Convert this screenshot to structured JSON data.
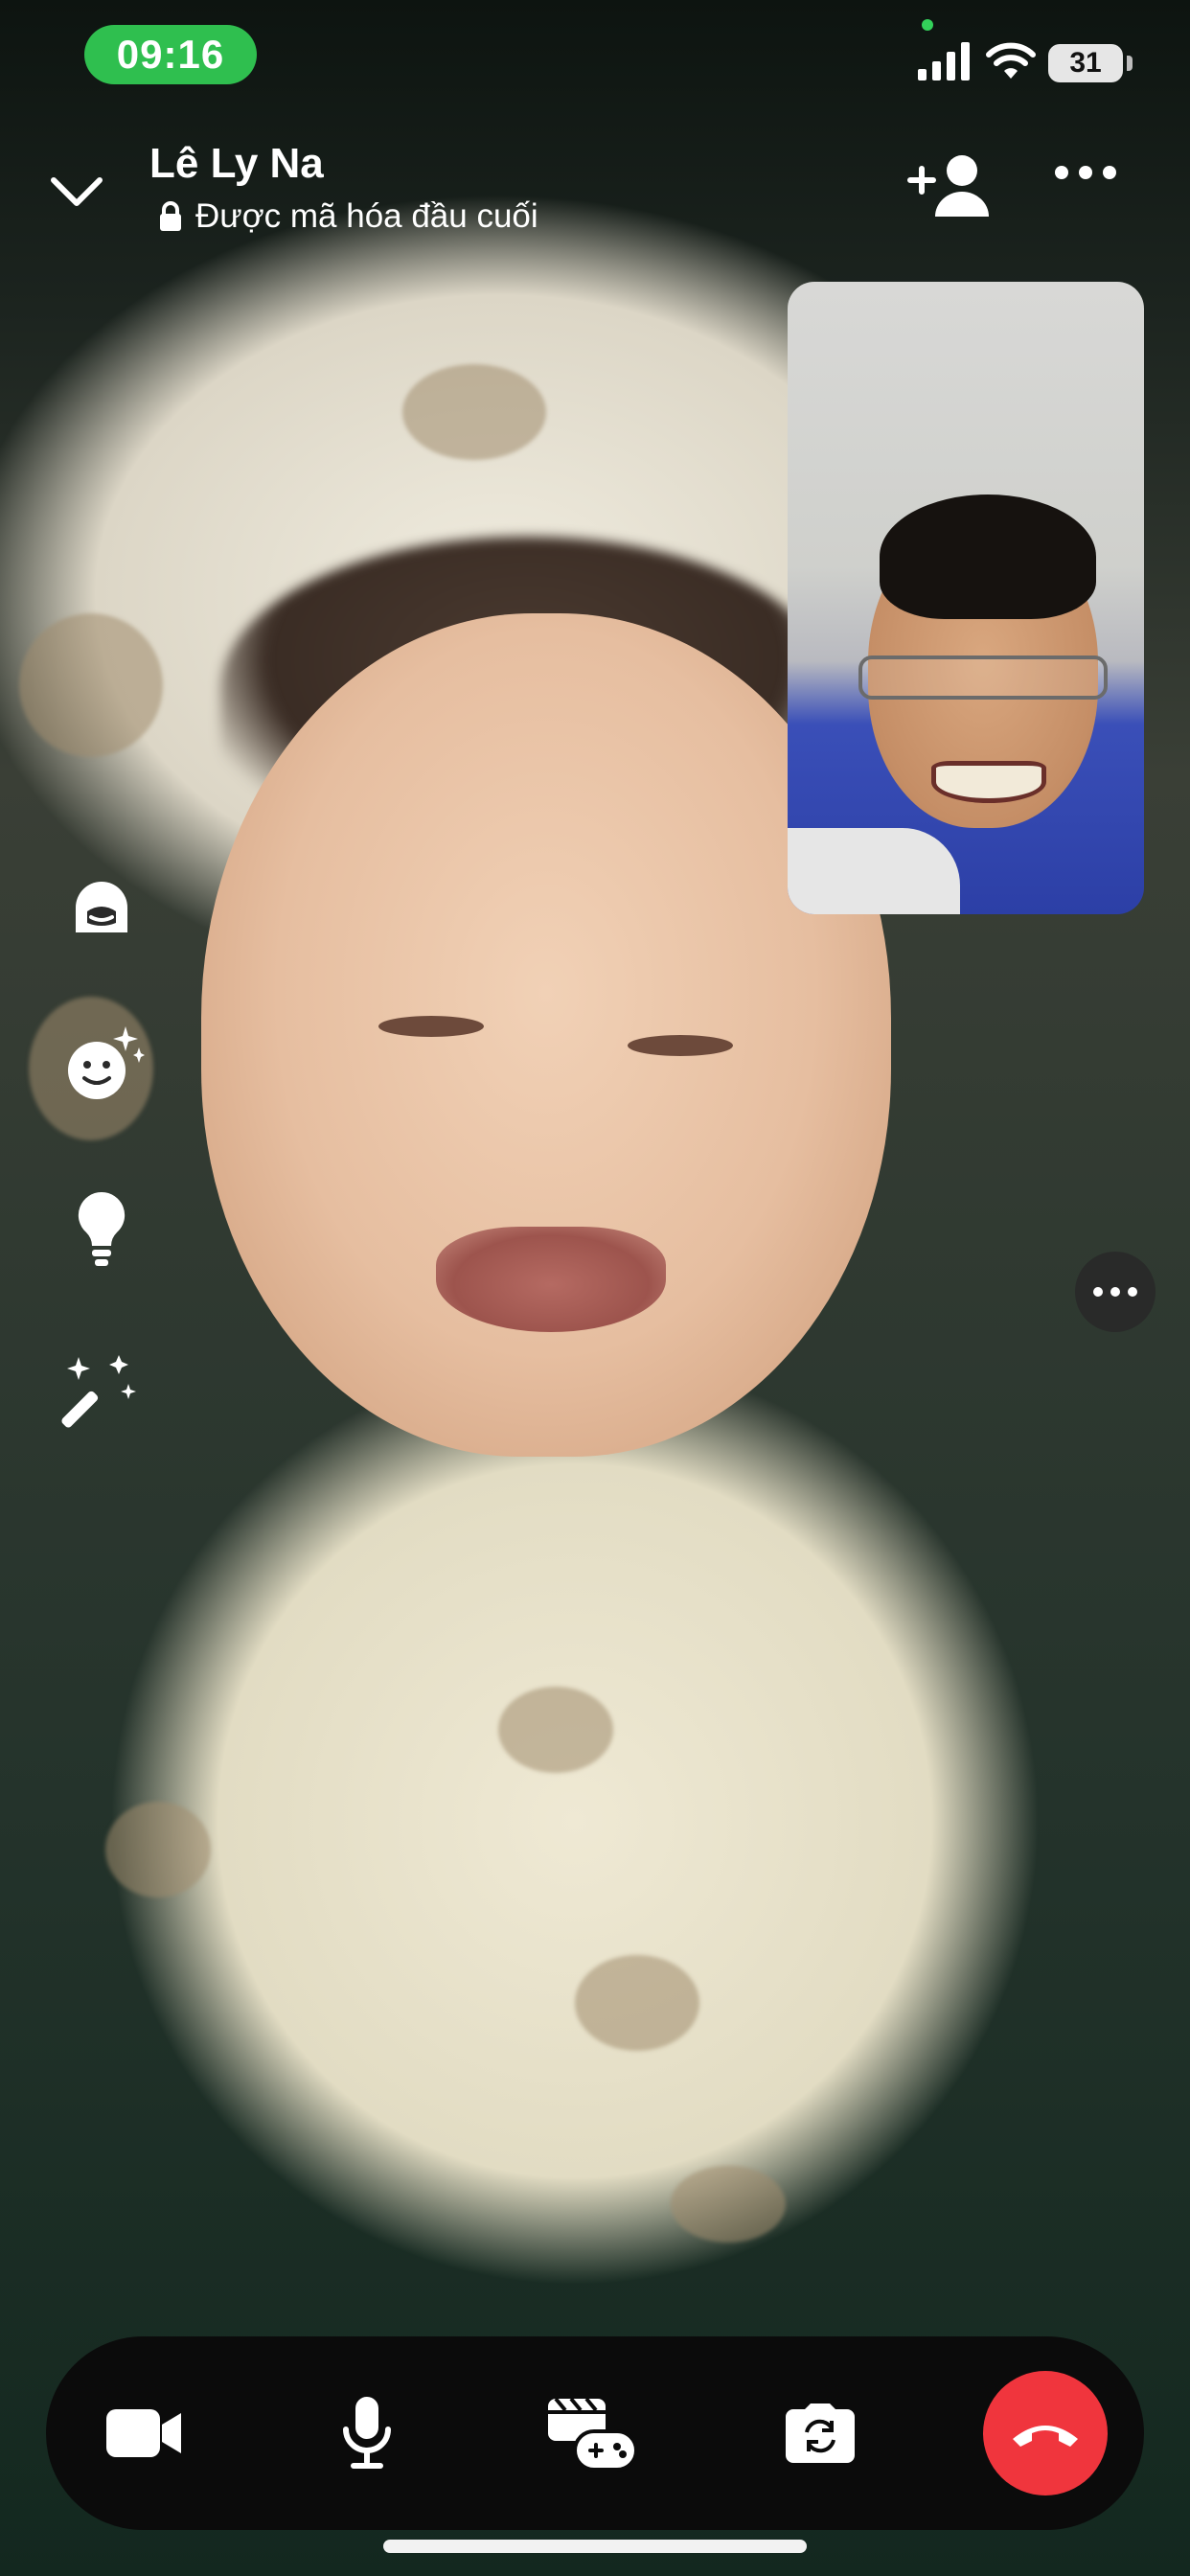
{
  "status_bar": {
    "time": "09:16",
    "battery": "31",
    "icons": [
      "signal-icon",
      "wifi-icon",
      "battery-icon"
    ]
  },
  "header": {
    "name": "Lê Ly Na",
    "encryption": "Được mã hóa đầu cuối",
    "icons": [
      "chevron-down-icon",
      "lock-icon",
      "add-person-icon",
      "more-horizontal-icon"
    ]
  },
  "side_tools": [
    "avatar-effect-icon",
    "face-sparkle-icon",
    "lightbulb-icon",
    "magic-wand-icon"
  ],
  "controls": [
    "video-camera-icon",
    "microphone-icon",
    "games-icon",
    "flip-camera-icon",
    "end-call-icon"
  ],
  "colors": {
    "time_pill": "#2fbf4f",
    "end_call": "#f0353d",
    "control_bar": "#0b0b0b"
  }
}
